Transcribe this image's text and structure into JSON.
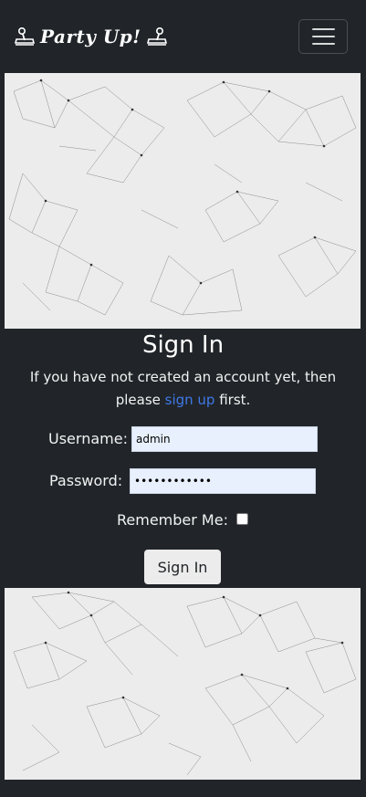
{
  "navbar": {
    "brand": "Party Up!",
    "brand_left_icon": "joystick-icon",
    "brand_right_icon": "joystick-icon",
    "menu_icon": "hamburger-menu-icon"
  },
  "form": {
    "title": "Sign In",
    "intro_before": "If you have not created an account yet, then please ",
    "signup_link": "sign up",
    "intro_after": " first.",
    "username_label": "Username:",
    "username_value": "admin",
    "password_label": "Password:",
    "password_value": "••••••••••••",
    "remember_label": "Remember Me:",
    "remember_checked": false,
    "submit_label": "Sign In"
  },
  "colors": {
    "background": "#212529",
    "panel": "#ececec",
    "link": "#3f78e8",
    "input_autofill": "#e8f0fe"
  }
}
